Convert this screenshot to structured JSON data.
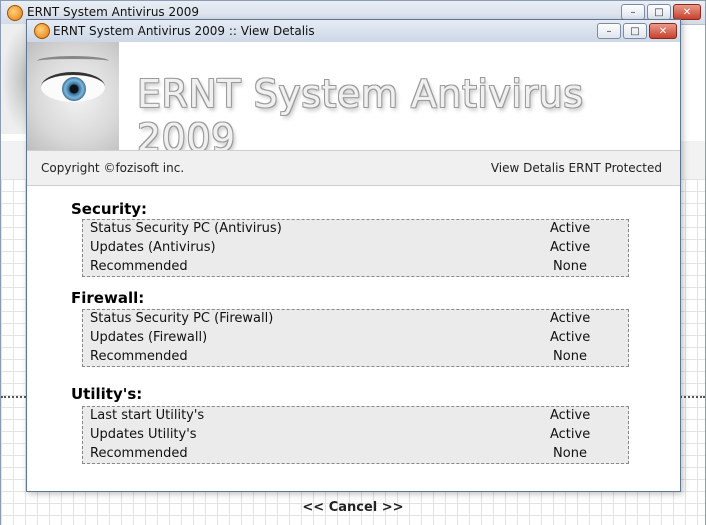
{
  "background_window": {
    "title": "ERNT System Antivirus 2009",
    "cancel_label": "<< Cancel >>"
  },
  "dialog": {
    "title": "ERNT System Antivirus 2009 :: View Detalis",
    "banner_title": "ERNT System Antivirus 2009",
    "copyright": "Copyright ©fozisoft inc.",
    "protected_label": "View Detalis ERNT Protected",
    "sections": [
      {
        "title": "Security:",
        "rows": [
          {
            "label": "Status Security PC (Antivirus)",
            "value": "Active"
          },
          {
            "label": "Updates (Antivirus)",
            "value": "Active"
          },
          {
            "label": "Recommended",
            "value": "None"
          }
        ]
      },
      {
        "title": "Firewall:",
        "rows": [
          {
            "label": "Status Security PC (Firewall)",
            "value": "Active"
          },
          {
            "label": "Updates (Firewall)",
            "value": "Active"
          },
          {
            "label": "Recommended",
            "value": "None"
          }
        ]
      },
      {
        "title": "Utility's:",
        "rows": [
          {
            "label": "Last start Utility's",
            "value": "Active"
          },
          {
            "label": "Updates Utility's",
            "value": "Active"
          },
          {
            "label": "Recommended",
            "value": "None"
          }
        ]
      }
    ]
  },
  "window_buttons": {
    "minimize": "–",
    "maximize": "□",
    "close": "✕"
  },
  "colors": {
    "titlebar": "#d4dce8",
    "box_bg": "#ebebeb",
    "close_button": "#c8412d"
  }
}
